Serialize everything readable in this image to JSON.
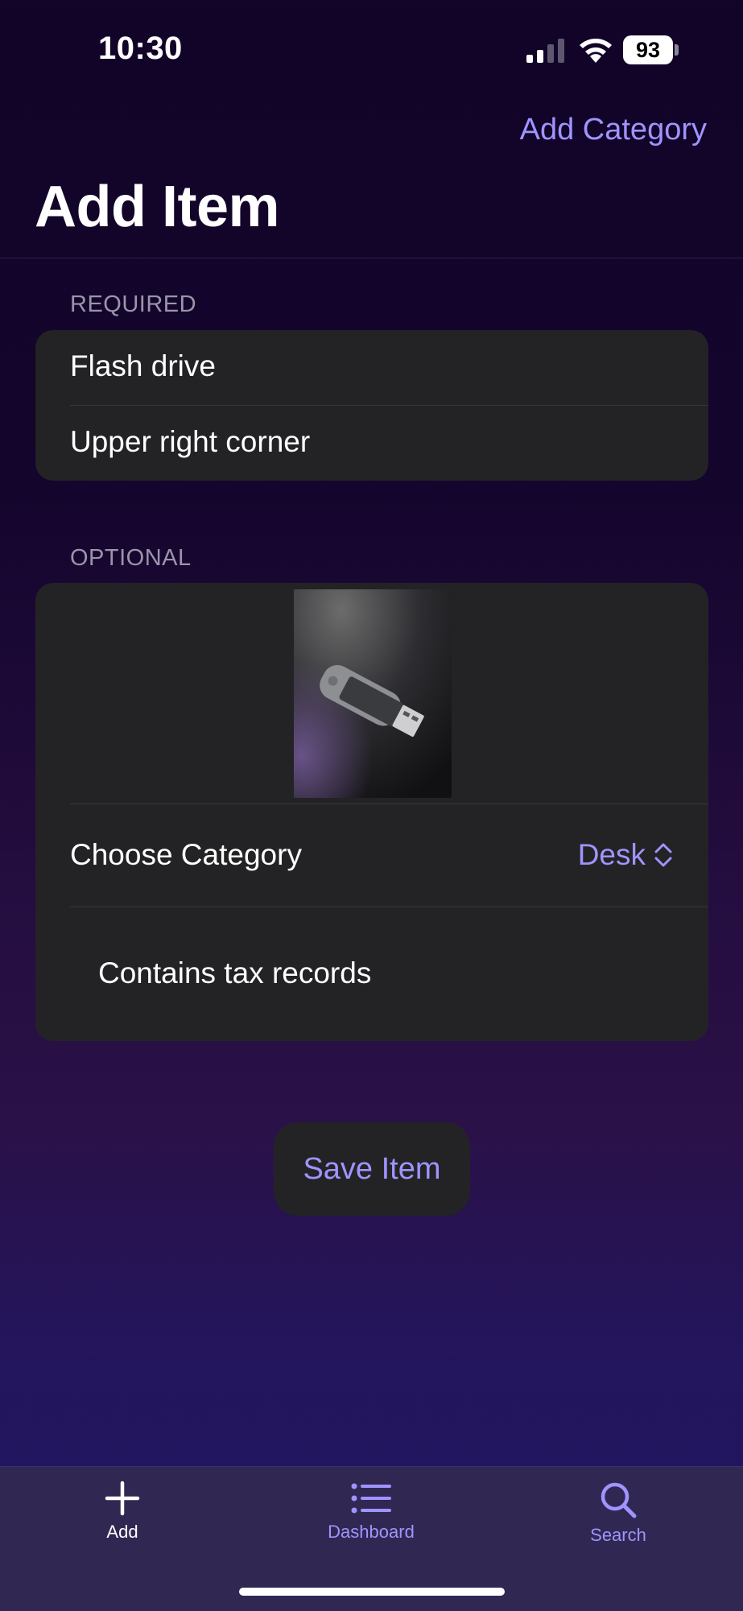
{
  "status_bar": {
    "time": "10:30",
    "battery": "93"
  },
  "nav": {
    "action_label": "Add Category",
    "title": "Add Item"
  },
  "required": {
    "header": "REQUIRED",
    "name_value": "Flash drive",
    "location_value": "Upper right corner"
  },
  "optional": {
    "header": "OPTIONAL",
    "photo_alt": "Flash drive photo",
    "category_label": "Choose Category",
    "category_value": "Desk",
    "notes_value": "Contains tax records"
  },
  "save_label": "Save Item",
  "tabs": [
    {
      "label": "Add",
      "icon": "plus-icon",
      "active": true
    },
    {
      "label": "Dashboard",
      "icon": "list-icon",
      "active": false
    },
    {
      "label": "Search",
      "icon": "magnifier-icon",
      "active": false
    }
  ],
  "colors": {
    "accent": "#9f94ff",
    "card": "#232325",
    "tabbar": "#302852",
    "header_text": "#9a95a8"
  }
}
